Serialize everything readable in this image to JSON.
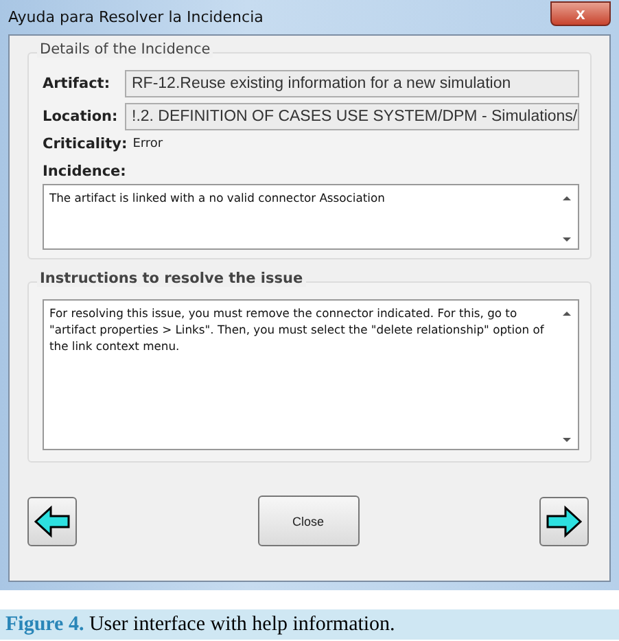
{
  "window": {
    "title": "Ayuda para Resolver la Incidencia",
    "close": "x"
  },
  "details": {
    "title": "Details of the Incidence",
    "artifact": {
      "label": "Artifact:",
      "value": "RF-12.Reuse existing information for a new simulation"
    },
    "location": {
      "label": "Location:",
      "value": "!.2. DEFINITION OF CASES USE SYSTEM/DPM - Simulations/"
    },
    "criticality": {
      "label": "Criticality:",
      "value": "Error"
    },
    "incidence": {
      "label": "Incidence:",
      "value": "The artifact is linked with a no valid connector Association"
    }
  },
  "instructions": {
    "title": "Instructions to resolve the issue",
    "value": "For resolving this issue, you must remove the connector indicated. For this, go to \"artifact properties > Links\". Then, you must select the \"delete relationship\" option of the link context menu."
  },
  "buttons": {
    "close": "Close"
  },
  "caption": {
    "number": "Figure 4.",
    "text": "User interface with help information."
  }
}
